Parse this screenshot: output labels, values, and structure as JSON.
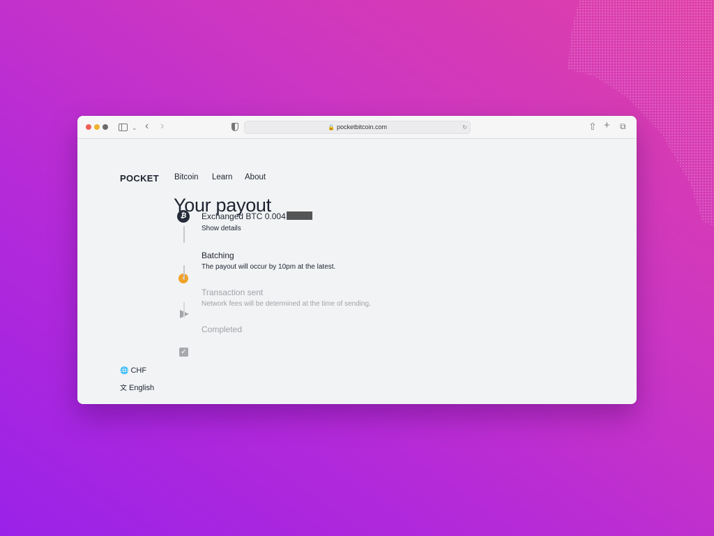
{
  "browser": {
    "url": "pocketbitcoin.com"
  },
  "site": {
    "logo": "POCKET",
    "nav": [
      "Bitcoin",
      "Learn",
      "About"
    ]
  },
  "page": {
    "title": "Your payout",
    "steps": [
      {
        "title": "Exchanged BTC 0.004",
        "subtitle": "Show details",
        "state": "done",
        "icon": "bitcoin-icon"
      },
      {
        "title": "Batching",
        "subtitle": "The payout will occur by 10pm at the latest.",
        "state": "active",
        "icon": "clock-icon"
      },
      {
        "title": "Transaction sent",
        "subtitle": "Network fees will be determined at the time of sending.",
        "state": "pending",
        "icon": "send-icon"
      },
      {
        "title": "Completed",
        "subtitle": "",
        "state": "pending",
        "icon": "check-icon"
      }
    ]
  },
  "footer": {
    "currency": "CHF",
    "language": "English"
  },
  "colors": {
    "accent_orange": "#f0a229",
    "dark": "#1d2430",
    "muted": "#a0a2a6"
  }
}
